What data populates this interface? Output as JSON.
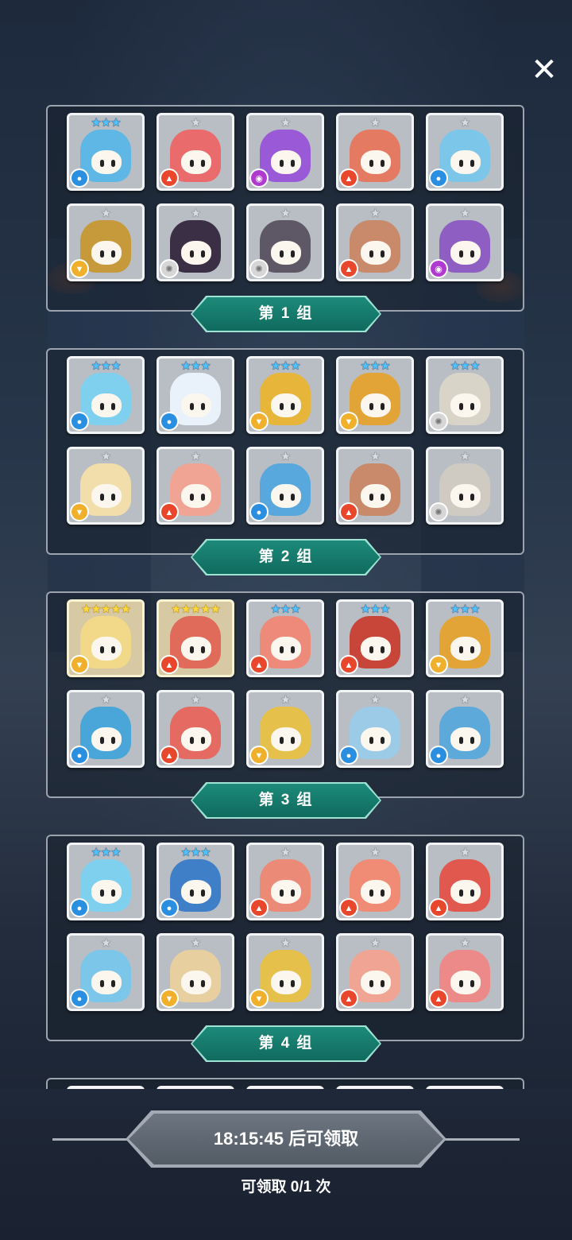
{
  "close_icon": "close-icon",
  "groups": [
    {
      "label": "第 1 组",
      "cards": [
        {
          "stars": 3,
          "star_color": "blue",
          "element": "water",
          "color": "#5fb7e6"
        },
        {
          "stars": 1,
          "star_color": "silver",
          "element": "fire",
          "color": "#ea6b6b"
        },
        {
          "stars": 1,
          "star_color": "silver",
          "element": "dark",
          "color": "#9a5ad8"
        },
        {
          "stars": 1,
          "star_color": "silver",
          "element": "fire",
          "color": "#e57a62"
        },
        {
          "stars": 1,
          "star_color": "silver",
          "element": "water",
          "color": "#7cc6ea"
        },
        {
          "stars": 1,
          "star_color": "silver",
          "element": "wind",
          "color": "#c69a3a"
        },
        {
          "stars": 1,
          "star_color": "silver",
          "element": "light",
          "color": "#3a2f45"
        },
        {
          "stars": 1,
          "star_color": "silver",
          "element": "light",
          "color": "#5e5866"
        },
        {
          "stars": 1,
          "star_color": "silver",
          "element": "fire",
          "color": "#c98a6c"
        },
        {
          "stars": 1,
          "star_color": "silver",
          "element": "dark",
          "color": "#8f5ec2"
        }
      ]
    },
    {
      "label": "第 2 组",
      "cards": [
        {
          "stars": 3,
          "star_color": "blue",
          "element": "water",
          "color": "#7ed0ee"
        },
        {
          "stars": 3,
          "star_color": "blue",
          "element": "water",
          "color": "#e9f2fb"
        },
        {
          "stars": 3,
          "star_color": "blue",
          "element": "wind",
          "color": "#e6b53a"
        },
        {
          "stars": 3,
          "star_color": "blue",
          "element": "wind",
          "color": "#e2a436"
        },
        {
          "stars": 3,
          "star_color": "blue",
          "element": "light",
          "color": "#d9d4c8"
        },
        {
          "stars": 1,
          "star_color": "silver",
          "element": "wind",
          "color": "#f1deaa"
        },
        {
          "stars": 1,
          "star_color": "silver",
          "element": "fire",
          "color": "#f0a494"
        },
        {
          "stars": 1,
          "star_color": "silver",
          "element": "water",
          "color": "#58a8de"
        },
        {
          "stars": 1,
          "star_color": "silver",
          "element": "fire",
          "color": "#c98a6c"
        },
        {
          "stars": 1,
          "star_color": "silver",
          "element": "light",
          "color": "#cfcbc2"
        }
      ]
    },
    {
      "label": "第 3 组",
      "cards": [
        {
          "stars": 5,
          "star_color": "gold",
          "element": "wind",
          "color": "#f2d98a",
          "gold": true
        },
        {
          "stars": 5,
          "star_color": "gold",
          "element": "fire",
          "color": "#e06b5a",
          "gold": true
        },
        {
          "stars": 3,
          "star_color": "blue",
          "element": "fire",
          "color": "#ee8a7a"
        },
        {
          "stars": 3,
          "star_color": "blue",
          "element": "fire",
          "color": "#c8453a"
        },
        {
          "stars": 3,
          "star_color": "blue",
          "element": "wind",
          "color": "#e2a436"
        },
        {
          "stars": 1,
          "star_color": "silver",
          "element": "water",
          "color": "#4aa6d8"
        },
        {
          "stars": 1,
          "star_color": "silver",
          "element": "fire",
          "color": "#e46a62"
        },
        {
          "stars": 1,
          "star_color": "silver",
          "element": "wind",
          "color": "#e5c04a"
        },
        {
          "stars": 1,
          "star_color": "silver",
          "element": "water",
          "color": "#9ccbe8"
        },
        {
          "stars": 1,
          "star_color": "silver",
          "element": "water",
          "color": "#5da9d9"
        }
      ]
    },
    {
      "label": "第 4 组",
      "cards": [
        {
          "stars": 3,
          "star_color": "blue",
          "element": "water",
          "color": "#7ed0ee"
        },
        {
          "stars": 3,
          "star_color": "blue",
          "element": "water",
          "color": "#3f7fc8"
        },
        {
          "stars": 1,
          "star_color": "silver",
          "element": "fire",
          "color": "#ec8a78"
        },
        {
          "stars": 1,
          "star_color": "silver",
          "element": "fire",
          "color": "#f08c76"
        },
        {
          "stars": 1,
          "star_color": "silver",
          "element": "fire",
          "color": "#e0584e"
        },
        {
          "stars": 1,
          "star_color": "silver",
          "element": "water",
          "color": "#7cc6ea"
        },
        {
          "stars": 1,
          "star_color": "silver",
          "element": "wind",
          "color": "#e8cfa0"
        },
        {
          "stars": 1,
          "star_color": "silver",
          "element": "wind",
          "color": "#e5c04a"
        },
        {
          "stars": 1,
          "star_color": "silver",
          "element": "fire",
          "color": "#f0a494"
        },
        {
          "stars": 1,
          "star_color": "silver",
          "element": "fire",
          "color": "#ec8a8a"
        }
      ]
    }
  ],
  "timer": {
    "label": "18:15:45 后可领取"
  },
  "claim": {
    "label": "可领取 0/1 次"
  },
  "colors": {
    "group_label_bg": "#137a6b",
    "timer_button_bg": "#606873"
  }
}
